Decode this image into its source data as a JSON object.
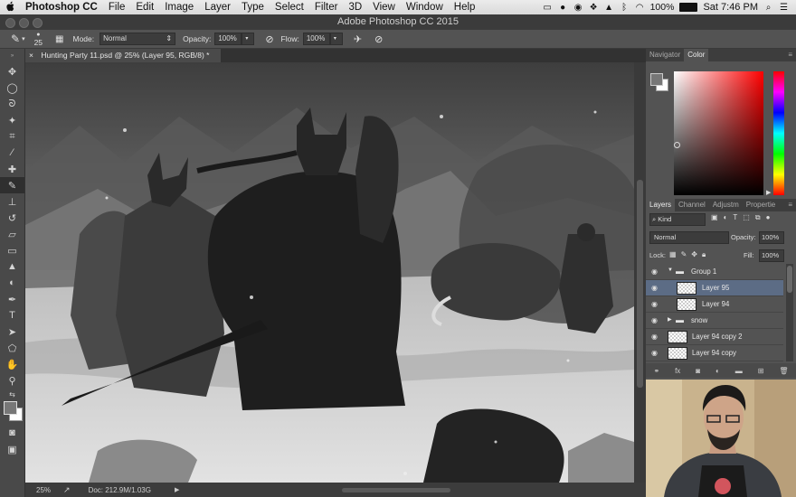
{
  "menubar": {
    "apple": "",
    "app_name": "Photoshop CC",
    "menus": [
      "File",
      "Edit",
      "Image",
      "Layer",
      "Type",
      "Select",
      "Filter",
      "3D",
      "View",
      "Window",
      "Help"
    ],
    "battery": "100%",
    "clock": "Sat 7:46 PM"
  },
  "window": {
    "title": "Adobe Photoshop CC 2015"
  },
  "options": {
    "brush_size": "25",
    "mode_label": "Mode:",
    "mode_value": "Normal",
    "opacity_label": "Opacity:",
    "opacity_value": "100%",
    "flow_label": "Flow:",
    "flow_value": "100%"
  },
  "document": {
    "tab_title": "Hunting Party 11.psd @ 25% (Layer 95, RGB/8) *",
    "close_glyph": "×"
  },
  "status": {
    "zoom": "25%",
    "doc": "Doc: 212.9M/1.03G"
  },
  "top_panel": {
    "tabs": [
      "Navigator",
      "Color"
    ],
    "active": "Color"
  },
  "layers_panel": {
    "tabs": [
      "Layers",
      "Channel",
      "Adjustm",
      "Propertie"
    ],
    "active": "Layers",
    "kind_label": "Kind",
    "blend_mode": "Normal",
    "opacity_label": "Opacity:",
    "opacity_value": "100%",
    "lock_label": "Lock:",
    "fill_label": "Fill:",
    "fill_value": "100%",
    "layers": [
      {
        "name": "Group 1",
        "type": "group",
        "selected": false
      },
      {
        "name": "Layer 95",
        "type": "layer",
        "selected": true
      },
      {
        "name": "Layer 94",
        "type": "layer",
        "selected": false
      },
      {
        "name": "snow",
        "type": "group",
        "selected": false
      },
      {
        "name": "Layer 94 copy 2",
        "type": "layer",
        "selected": false
      },
      {
        "name": "Layer 94 copy",
        "type": "layer",
        "selected": false
      }
    ]
  },
  "colors": {
    "selection": "#5c6c85",
    "panel_bg": "#535353",
    "hue_top": "#ff0000",
    "foreground_swatch": "#777777"
  },
  "icons": {
    "toolbar": [
      "move-icon",
      "marquee-icon",
      "lasso-icon",
      "quick-select-icon",
      "crop-icon",
      "eyedropper-icon",
      "healing-icon",
      "brush-icon",
      "stamp-icon",
      "history-brush-icon",
      "eraser-icon",
      "gradient-icon",
      "blur-icon",
      "dodge-icon",
      "pen-icon",
      "type-icon",
      "path-select-icon",
      "shape-icon",
      "hand-icon",
      "zoom-icon"
    ]
  }
}
